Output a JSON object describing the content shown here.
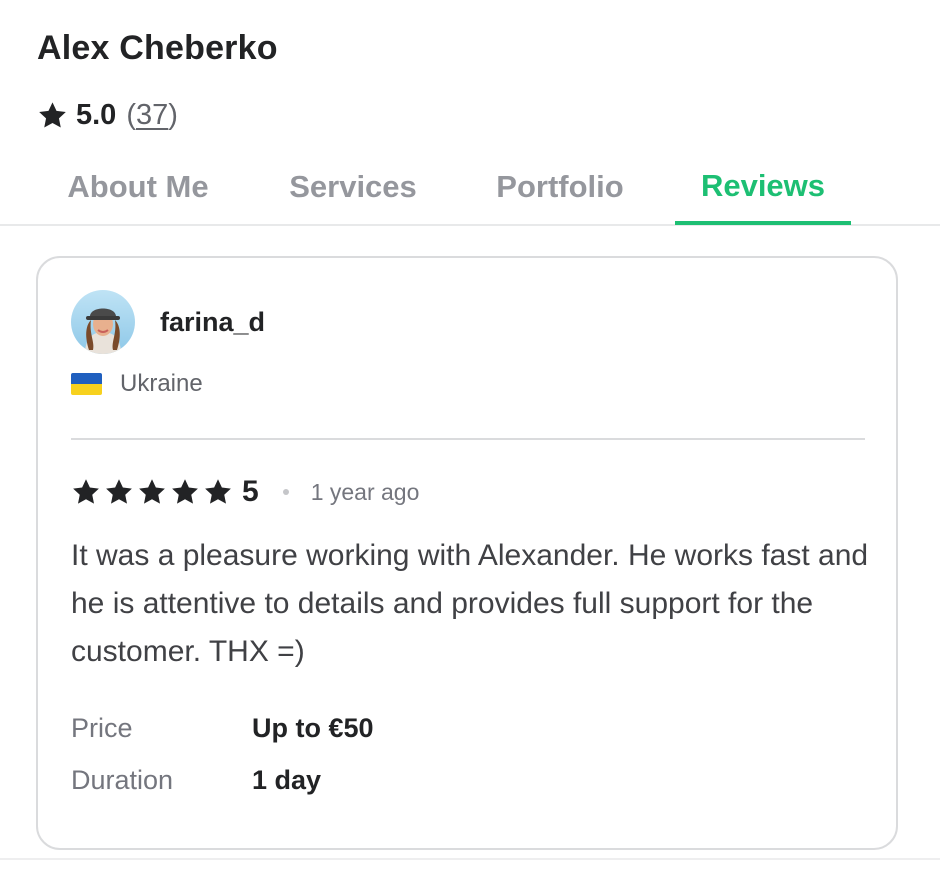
{
  "seller": {
    "name": "Alex Cheberko",
    "rating": "5.0",
    "review_count_open": "(",
    "review_count": "37",
    "review_count_close": ")"
  },
  "tabs": [
    {
      "label": "About Me",
      "active": false
    },
    {
      "label": "Services",
      "active": false
    },
    {
      "label": "Portfolio",
      "active": false
    },
    {
      "label": "Reviews",
      "active": true
    }
  ],
  "review": {
    "reviewer": "farina_d",
    "country": "Ukraine",
    "stars": 5,
    "score": "5",
    "time": "1 year ago",
    "text": "It was a pleasure working with Alexander. He works fast and he is attentive to details and provides full support for the customer. THX =)",
    "price_label": "Price",
    "price_value": "Up to €50",
    "duration_label": "Duration",
    "duration_value": "1 day"
  },
  "colors": {
    "accent": "#1dbf73",
    "text": "#222325",
    "muted": "#62646a",
    "border": "#dadbdd",
    "flag_blue": "#1f5fbf",
    "flag_yellow": "#f7d11e"
  },
  "icons": [
    "star-icon",
    "ukraine-flag-icon",
    "reviewer-avatar"
  ]
}
